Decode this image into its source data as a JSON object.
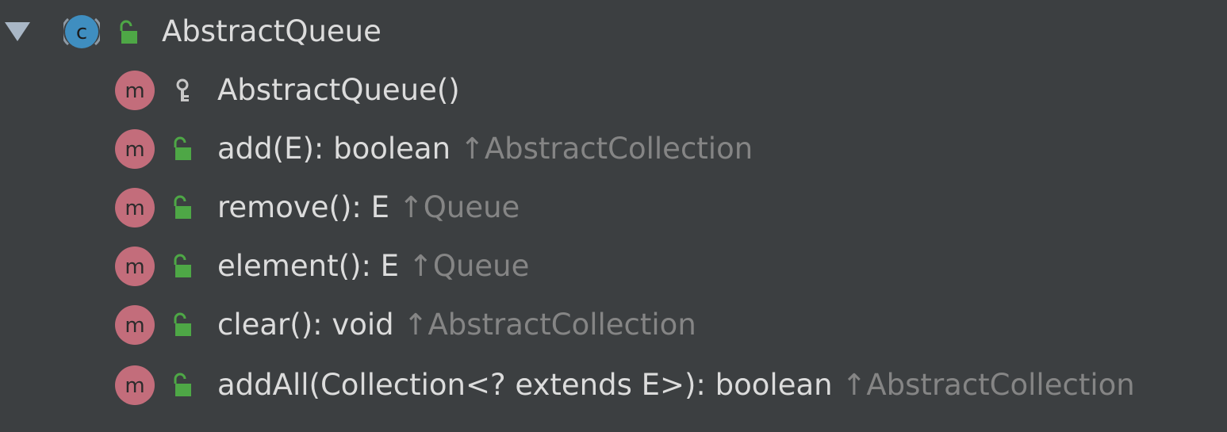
{
  "colors": {
    "background": "#3c3f41",
    "text": "#dcdcdc",
    "inherited_text": "#858585",
    "method_badge": "#c36d7b",
    "class_badge": "#3f8ec0",
    "public_lock": "#4ea746"
  },
  "tree": {
    "class_node": {
      "name": "AbstractQueue",
      "expanded": true,
      "icon": "class-icon",
      "visibility_icon": "public-lock-icon"
    },
    "members": [
      {
        "signature": "AbstractQueue()",
        "inherited_from": "",
        "icon": "method-icon",
        "visibility_icon": "protected-key-icon"
      },
      {
        "signature": "add(E): boolean",
        "inherited_from": "↑AbstractCollection",
        "icon": "method-icon",
        "visibility_icon": "public-lock-icon"
      },
      {
        "signature": "remove(): E",
        "inherited_from": "↑Queue",
        "icon": "method-icon",
        "visibility_icon": "public-lock-icon"
      },
      {
        "signature": "element(): E",
        "inherited_from": "↑Queue",
        "icon": "method-icon",
        "visibility_icon": "public-lock-icon"
      },
      {
        "signature": "clear(): void",
        "inherited_from": "↑AbstractCollection",
        "icon": "method-icon",
        "visibility_icon": "public-lock-icon"
      },
      {
        "signature": "addAll(Collection<? extends E>): boolean",
        "inherited_from": "↑AbstractCollection",
        "icon": "method-icon",
        "visibility_icon": "public-lock-icon"
      }
    ]
  }
}
